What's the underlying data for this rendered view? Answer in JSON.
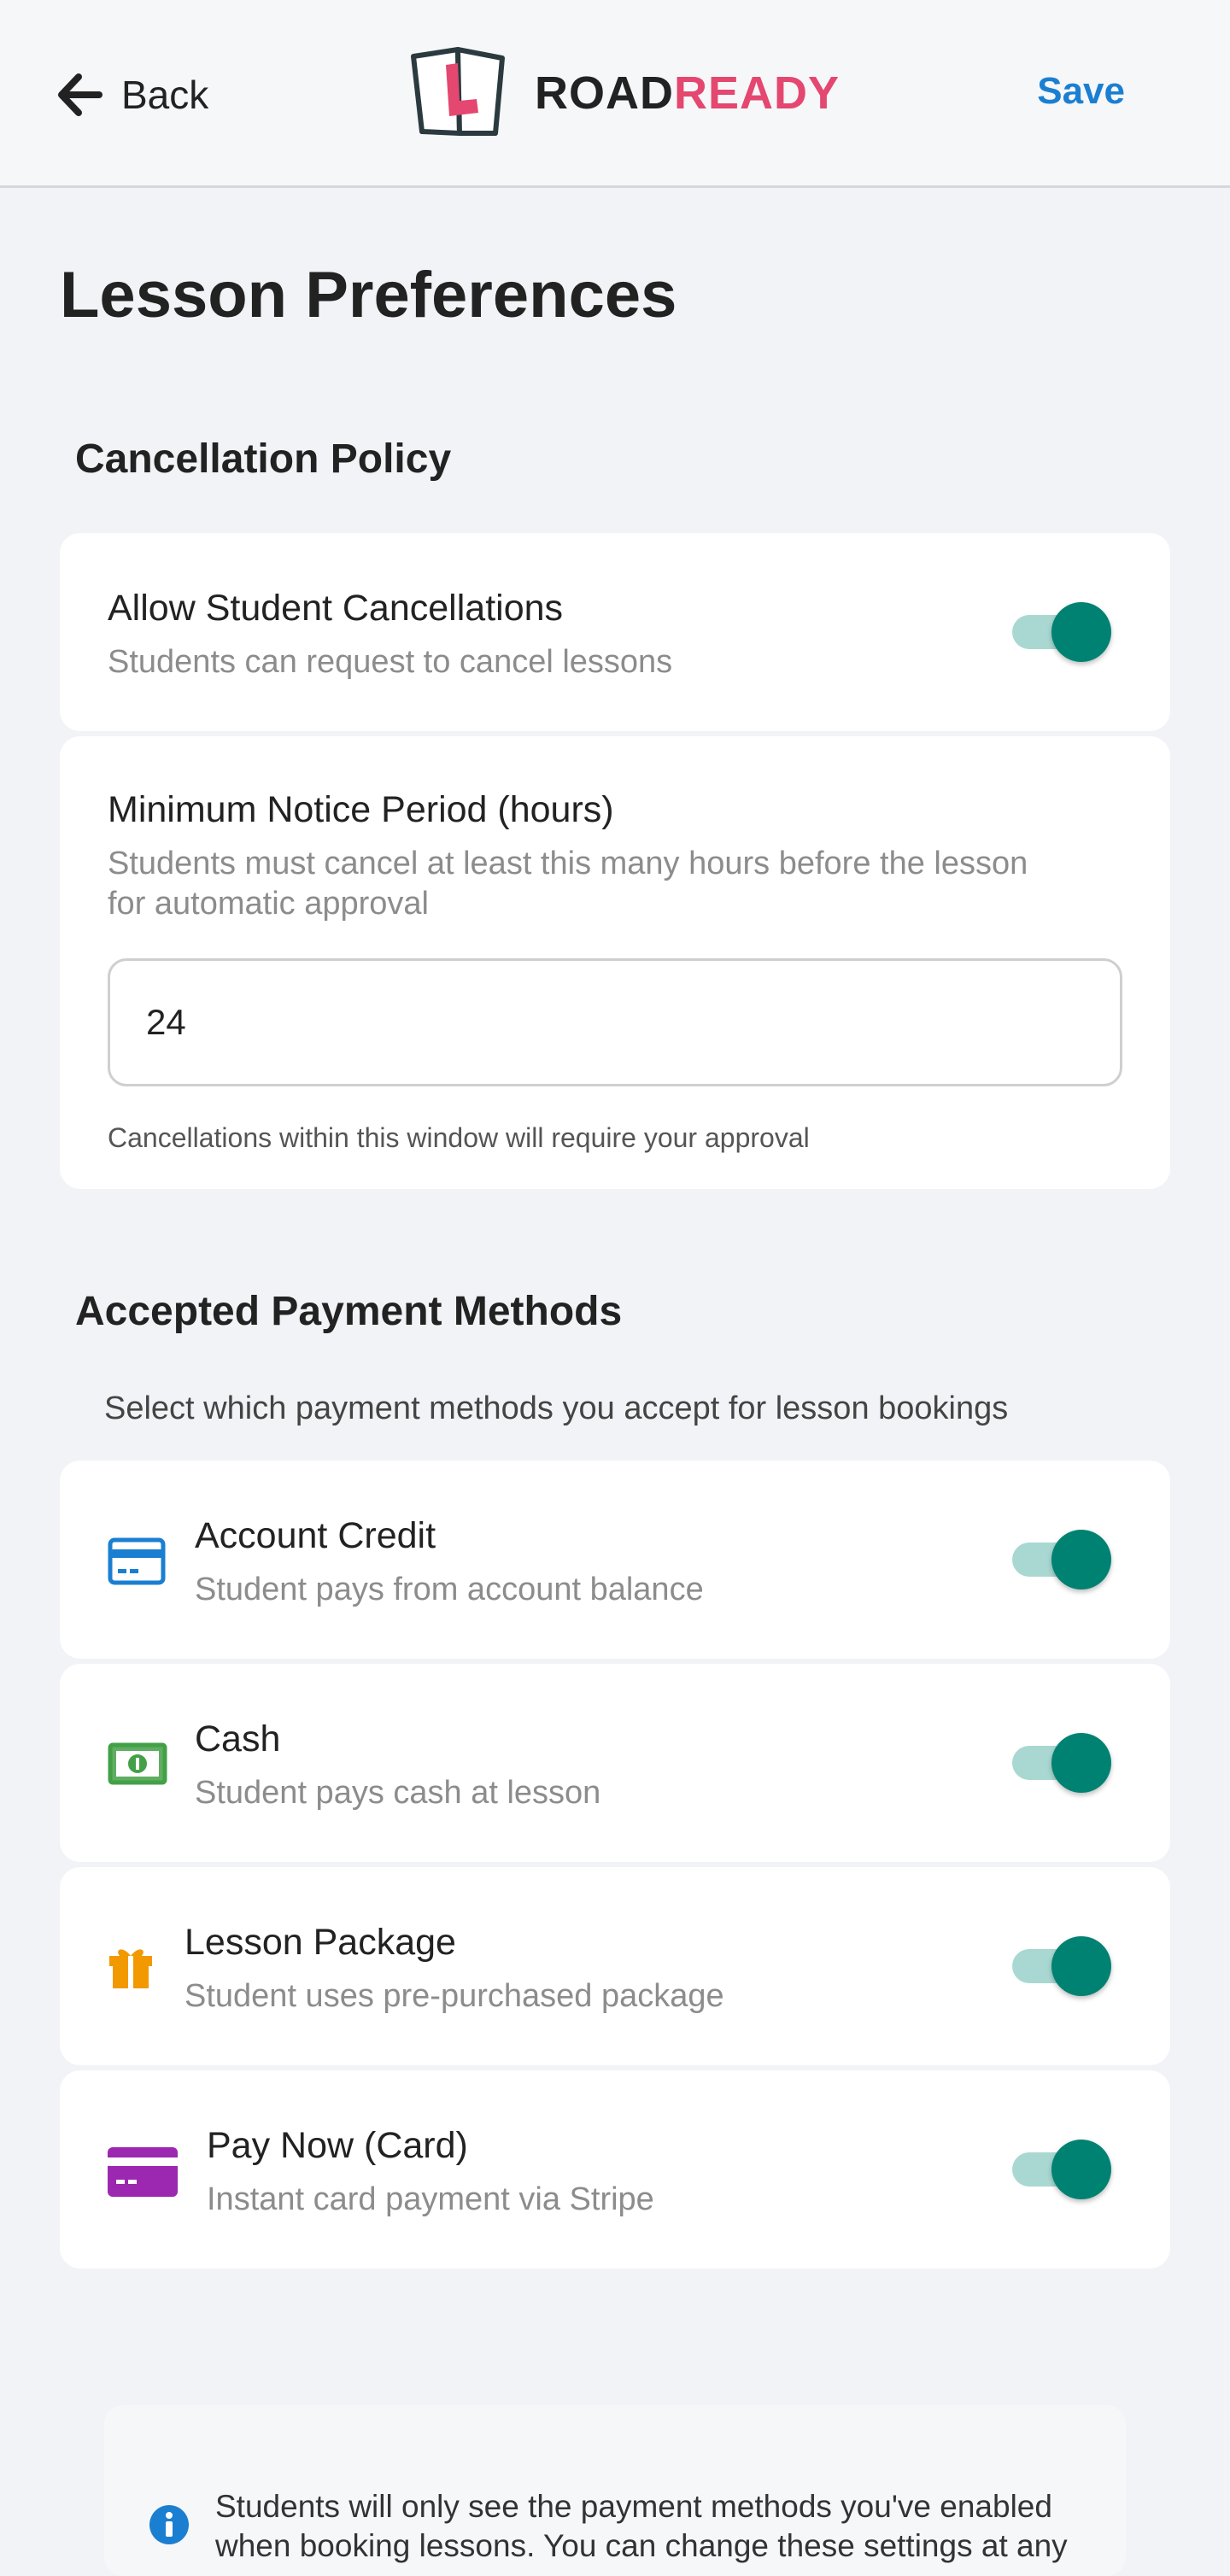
{
  "header": {
    "back_label": "Back",
    "brand_road": "ROAD",
    "brand_ready": "READY",
    "save_label": "Save"
  },
  "page": {
    "title": "Lesson Preferences"
  },
  "cancellation": {
    "section_title": "Cancellation Policy",
    "allow": {
      "title": "Allow Student Cancellations",
      "subtitle": "Students can request to cancel lessons",
      "enabled": true
    },
    "notice": {
      "title": "Minimum Notice Period (hours)",
      "description_line1": "Students must cancel at least this many hours before the lesson",
      "description_line2": "for automatic approval",
      "value": "24",
      "helper": "Cancellations within this window will require your approval"
    }
  },
  "payment": {
    "section_title": "Accepted Payment Methods",
    "description": "Select which payment methods you accept for lesson bookings",
    "methods": [
      {
        "title": "Account Credit",
        "subtitle": "Student pays from account balance",
        "icon": "credit-card-icon",
        "enabled": true
      },
      {
        "title": "Cash",
        "subtitle": "Student pays cash at lesson",
        "icon": "cash-icon",
        "enabled": true
      },
      {
        "title": "Lesson Package",
        "subtitle": "Student uses pre-purchased package",
        "icon": "gift-icon",
        "enabled": true
      },
      {
        "title": "Pay Now (Card)",
        "subtitle": "Instant card payment via Stripe",
        "icon": "card-icon",
        "enabled": true
      }
    ]
  },
  "info": {
    "text": "Students will only see the payment methods you've enabled when booking lessons. You can change these settings at any"
  },
  "colors": {
    "accent_blue": "#1b7fd1",
    "brand_pink": "#e4476f",
    "toggle_on": "#008272",
    "toggle_track": "#a9d8d2"
  }
}
